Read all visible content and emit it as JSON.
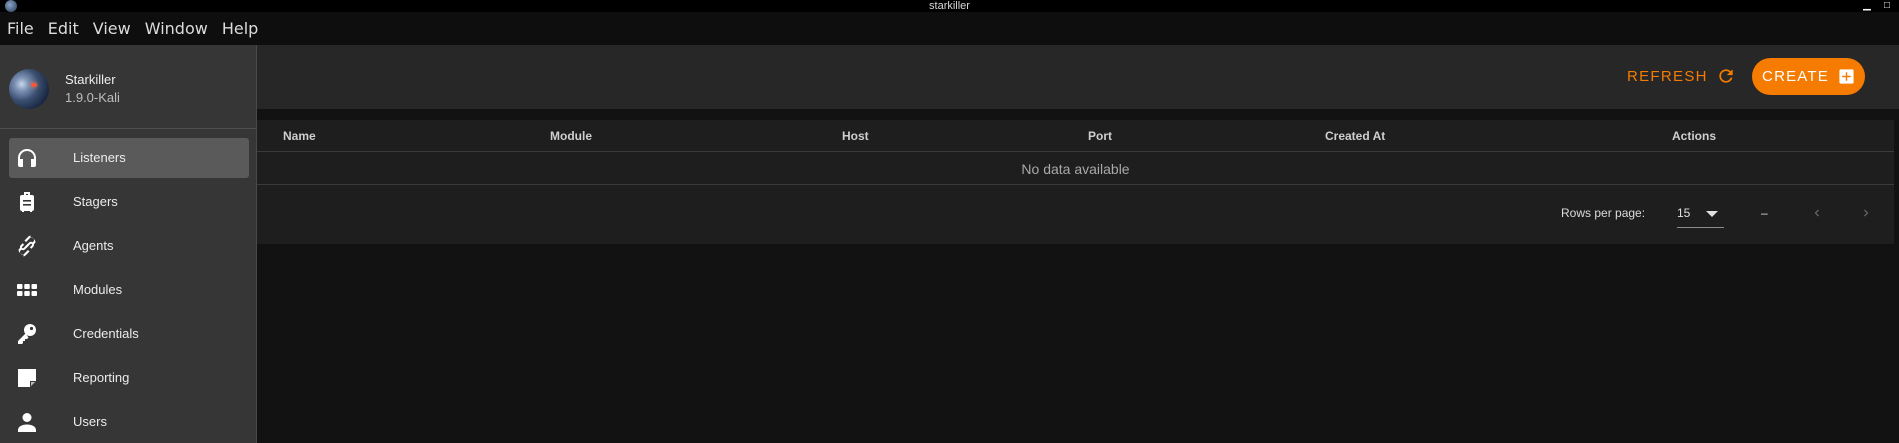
{
  "window": {
    "title": "starkiller",
    "minimize_glyph": "▁",
    "maximize_glyph": "□"
  },
  "menubar": {
    "items": [
      "File",
      "Edit",
      "View",
      "Window",
      "Help"
    ]
  },
  "drawer": {
    "profile": {
      "name": "Starkiller",
      "version": "1.9.0-Kali"
    },
    "items": [
      {
        "label": "Listeners",
        "icon": "headphones-icon",
        "active": true
      },
      {
        "label": "Stagers",
        "icon": "luggage-icon",
        "active": false
      },
      {
        "label": "Agents",
        "icon": "link-icon",
        "active": false
      },
      {
        "label": "Modules",
        "icon": "apps-grid-icon",
        "active": false
      },
      {
        "label": "Credentials",
        "icon": "key-icon",
        "active": false
      },
      {
        "label": "Reporting",
        "icon": "sticky-note-icon",
        "active": false
      },
      {
        "label": "Users",
        "icon": "user-icon",
        "active": false
      }
    ]
  },
  "toolbar": {
    "refresh_label": "REFRESH",
    "create_label": "CREATE"
  },
  "table": {
    "columns": [
      "Name",
      "Module",
      "Host",
      "Port",
      "Created At",
      "Actions"
    ],
    "empty_text": "No data available",
    "footer": {
      "rows_per_page_label": "Rows per page:",
      "rows_per_page_value": "15",
      "range_text": "–"
    }
  },
  "colors": {
    "accent": "#f57c00",
    "drawer_bg": "#363636",
    "card_bg": "#1e1e1e",
    "page_bg": "#121212"
  }
}
